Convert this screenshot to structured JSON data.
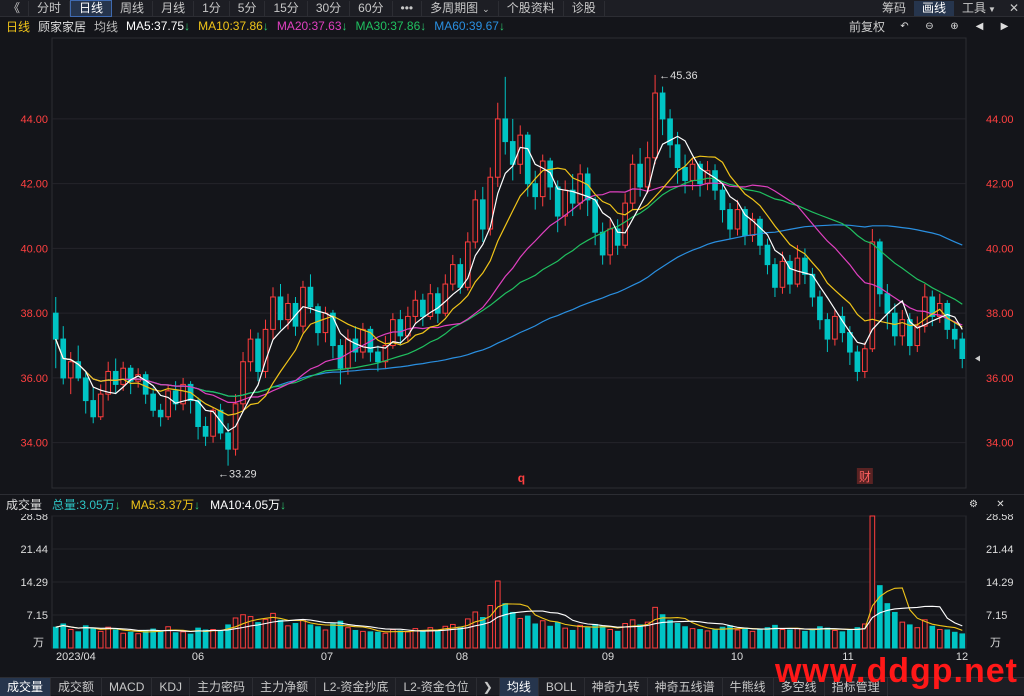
{
  "topbar": {
    "back": "《",
    "tabs": [
      "分时",
      "日线",
      "周线",
      "月线",
      "1分",
      "5分",
      "15分",
      "30分",
      "60分",
      "•••",
      "多周期图",
      "个股资料",
      "诊股"
    ],
    "active_tab": "日线",
    "dropdown_tab": "多周期图",
    "right": [
      "筹码",
      "画线",
      "工具"
    ],
    "right_active": "画线"
  },
  "ma_bar": {
    "period": "日线",
    "stock": "顾家家居",
    "label": "均线",
    "ma5": "MA5:37.75",
    "ma10": "MA10:37.86",
    "ma20": "MA20:37.63",
    "ma30": "MA30:37.86",
    "ma60": "MA60:39.67",
    "fuquan": "前复权"
  },
  "vol_bar": {
    "title": "成交量",
    "total": "总量:3.05万",
    "ma5": "MA5:3.37万",
    "ma10": "MA10:4.05万"
  },
  "bottombar": {
    "left_tabs": [
      "成交量",
      "成交额",
      "MACD",
      "KDJ",
      "主力密码",
      "主力净额",
      "L2-资金抄底",
      "L2-资金仓位"
    ],
    "left_active": "成交量",
    "right_tabs": [
      "均线",
      "BOLL",
      "神奇九转",
      "神奇五线谱",
      "牛熊线",
      "多空线",
      "指标管理"
    ],
    "right_active": "均线"
  },
  "watermark": "www.ddgp.net",
  "colors": {
    "up": "#ff3d3d",
    "down": "#00c4c4",
    "ma5": "#ffffff",
    "ma10": "#f0c419",
    "ma20": "#e040c0",
    "ma30": "#20c060",
    "ma60": "#2a8fe0"
  },
  "chart_data": {
    "type": "candlestick",
    "price_axis": {
      "ticks": [
        "44.00",
        "42.00",
        "40.00",
        "38.00",
        "36.00",
        "34.00"
      ],
      "range": [
        32.6,
        46.5
      ]
    },
    "volume_axis": {
      "ticks": [
        "28.58",
        "21.44",
        "14.29",
        "7.15"
      ],
      "unit": "万",
      "range": [
        0,
        28.58
      ]
    },
    "x_labels": [
      "2023/04",
      "06",
      "07",
      "08",
      "09",
      "10",
      "11",
      "12"
    ],
    "annotations": {
      "high": "45.36",
      "low": "33.29"
    },
    "event_markers": [
      "q",
      "财"
    ],
    "candles": [
      [
        38.0,
        37.2,
        38.5,
        36.3,
        4.5
      ],
      [
        37.2,
        36.0,
        37.6,
        35.8,
        5.2
      ],
      [
        36.0,
        36.5,
        36.8,
        35.5,
        4.0
      ],
      [
        36.5,
        36.0,
        37.0,
        35.9,
        3.5
      ],
      [
        36.0,
        35.3,
        36.2,
        34.9,
        4.8
      ],
      [
        35.3,
        34.8,
        35.7,
        34.6,
        4.2
      ],
      [
        34.8,
        35.5,
        35.8,
        34.7,
        3.6
      ],
      [
        35.5,
        36.2,
        36.5,
        35.3,
        4.5
      ],
      [
        36.2,
        35.8,
        36.6,
        35.5,
        3.9
      ],
      [
        35.8,
        36.3,
        36.5,
        35.6,
        3.2
      ],
      [
        36.3,
        35.9,
        36.4,
        35.5,
        3.4
      ],
      [
        35.9,
        36.1,
        36.3,
        35.7,
        3.1
      ],
      [
        36.1,
        35.5,
        36.2,
        35.2,
        3.8
      ],
      [
        35.5,
        35.0,
        35.7,
        34.8,
        4.1
      ],
      [
        35.0,
        34.8,
        35.2,
        34.5,
        3.7
      ],
      [
        34.8,
        35.6,
        35.8,
        34.7,
        4.6
      ],
      [
        35.6,
        35.2,
        35.9,
        35.0,
        3.3
      ],
      [
        35.2,
        35.8,
        36.0,
        35.0,
        3.5
      ],
      [
        35.8,
        35.3,
        35.9,
        34.9,
        3.0
      ],
      [
        35.3,
        34.5,
        35.4,
        34.1,
        4.3
      ],
      [
        34.5,
        34.2,
        34.8,
        33.9,
        3.9
      ],
      [
        34.2,
        35.0,
        35.1,
        34.0,
        4.0
      ],
      [
        35.0,
        34.3,
        35.2,
        34.1,
        3.6
      ],
      [
        34.3,
        33.8,
        34.6,
        33.29,
        5.0
      ],
      [
        33.8,
        35.2,
        35.5,
        33.6,
        6.5
      ],
      [
        35.2,
        36.5,
        36.8,
        35.0,
        7.2
      ],
      [
        36.5,
        37.2,
        37.5,
        36.2,
        6.8
      ],
      [
        37.2,
        36.2,
        37.4,
        35.9,
        5.5
      ],
      [
        36.2,
        37.5,
        37.8,
        36.0,
        6.2
      ],
      [
        37.5,
        38.5,
        38.8,
        37.2,
        7.5
      ],
      [
        38.5,
        37.8,
        38.9,
        37.5,
        6.0
      ],
      [
        37.8,
        38.3,
        38.6,
        37.5,
        4.8
      ],
      [
        38.3,
        37.6,
        38.5,
        37.3,
        5.3
      ],
      [
        37.6,
        38.8,
        39.0,
        37.4,
        6.1
      ],
      [
        38.8,
        38.2,
        39.2,
        38.0,
        5.0
      ],
      [
        38.2,
        37.4,
        38.3,
        37.0,
        4.6
      ],
      [
        37.4,
        38.0,
        38.2,
        37.1,
        3.9
      ],
      [
        38.0,
        37.0,
        38.1,
        36.6,
        5.2
      ],
      [
        37.0,
        36.3,
        37.2,
        35.8,
        5.8
      ],
      [
        36.3,
        37.2,
        37.5,
        36.1,
        4.4
      ],
      [
        37.2,
        36.8,
        37.6,
        36.5,
        3.8
      ],
      [
        36.8,
        37.5,
        37.7,
        36.6,
        3.6
      ],
      [
        37.5,
        36.8,
        37.6,
        36.5,
        3.5
      ],
      [
        36.8,
        36.5,
        37.0,
        36.2,
        3.4
      ],
      [
        36.5,
        37.0,
        37.3,
        36.3,
        3.2
      ],
      [
        37.0,
        37.8,
        38.0,
        36.9,
        4.0
      ],
      [
        37.8,
        37.3,
        38.1,
        37.0,
        3.7
      ],
      [
        37.3,
        37.9,
        38.2,
        37.1,
        3.5
      ],
      [
        37.9,
        38.4,
        38.7,
        37.7,
        4.2
      ],
      [
        38.4,
        37.9,
        38.6,
        37.6,
        3.6
      ],
      [
        37.9,
        38.6,
        38.9,
        37.8,
        4.4
      ],
      [
        38.6,
        38.0,
        38.8,
        37.7,
        3.9
      ],
      [
        38.0,
        38.9,
        39.2,
        37.9,
        4.7
      ],
      [
        38.9,
        39.5,
        39.8,
        38.7,
        5.1
      ],
      [
        39.5,
        38.8,
        39.7,
        38.6,
        4.5
      ],
      [
        38.8,
        40.2,
        40.5,
        38.7,
        6.3
      ],
      [
        40.2,
        41.5,
        41.8,
        40.0,
        7.8
      ],
      [
        41.5,
        40.6,
        41.9,
        40.2,
        6.6
      ],
      [
        40.6,
        42.2,
        42.5,
        40.4,
        9.2
      ],
      [
        42.2,
        44.0,
        44.5,
        41.9,
        14.5
      ],
      [
        44.0,
        43.3,
        45.3,
        42.9,
        9.6
      ],
      [
        43.3,
        42.6,
        44.0,
        42.1,
        7.7
      ],
      [
        42.6,
        43.5,
        43.8,
        42.3,
        6.4
      ],
      [
        43.5,
        42.0,
        43.6,
        41.6,
        6.9
      ],
      [
        42.0,
        41.6,
        42.4,
        41.2,
        5.2
      ],
      [
        41.6,
        42.7,
        42.9,
        41.3,
        5.9
      ],
      [
        42.7,
        41.9,
        42.8,
        41.5,
        4.7
      ],
      [
        41.9,
        41.0,
        42.1,
        40.5,
        5.5
      ],
      [
        41.0,
        41.8,
        42.1,
        40.7,
        4.3
      ],
      [
        41.8,
        41.4,
        42.3,
        41.0,
        3.8
      ],
      [
        41.4,
        42.3,
        42.6,
        41.2,
        4.9
      ],
      [
        42.3,
        41.5,
        42.5,
        41.0,
        4.4
      ],
      [
        41.5,
        40.5,
        41.6,
        40.1,
        5.1
      ],
      [
        40.5,
        39.8,
        40.8,
        39.5,
        4.7
      ],
      [
        39.8,
        40.6,
        40.9,
        39.5,
        4.0
      ],
      [
        40.6,
        40.1,
        40.9,
        39.8,
        3.6
      ],
      [
        40.1,
        41.4,
        41.7,
        40.0,
        5.3
      ],
      [
        41.4,
        42.6,
        42.9,
        41.2,
        6.1
      ],
      [
        42.6,
        41.9,
        43.1,
        41.6,
        5.0
      ],
      [
        41.9,
        42.8,
        43.3,
        41.7,
        5.6
      ],
      [
        42.8,
        44.8,
        45.36,
        42.6,
        8.8
      ],
      [
        44.8,
        44.0,
        45.0,
        43.5,
        7.2
      ],
      [
        44.0,
        43.2,
        44.3,
        42.8,
        6.0
      ],
      [
        43.2,
        42.5,
        43.6,
        42.0,
        5.3
      ],
      [
        42.5,
        42.1,
        42.9,
        41.7,
        4.6
      ],
      [
        42.1,
        42.6,
        42.8,
        41.8,
        4.2
      ],
      [
        42.6,
        42.0,
        42.7,
        41.6,
        4.0
      ],
      [
        42.0,
        42.4,
        42.7,
        41.8,
        3.7
      ],
      [
        42.4,
        41.8,
        42.6,
        41.5,
        3.9
      ],
      [
        41.8,
        41.2,
        42.0,
        40.8,
        4.5
      ],
      [
        41.2,
        40.6,
        41.4,
        40.3,
        4.8
      ],
      [
        40.6,
        41.2,
        41.5,
        40.4,
        3.9
      ],
      [
        41.2,
        40.4,
        41.3,
        40.1,
        4.3
      ],
      [
        40.4,
        40.9,
        41.1,
        40.2,
        3.6
      ],
      [
        40.9,
        40.1,
        41.0,
        39.8,
        4.1
      ],
      [
        40.1,
        39.5,
        40.3,
        39.2,
        4.4
      ],
      [
        39.5,
        38.8,
        39.7,
        38.5,
        4.9
      ],
      [
        38.8,
        39.6,
        39.9,
        38.6,
        4.0
      ],
      [
        39.6,
        38.9,
        39.8,
        38.6,
        3.9
      ],
      [
        38.9,
        39.7,
        40.1,
        38.8,
        4.2
      ],
      [
        39.7,
        39.2,
        40.0,
        38.9,
        3.6
      ],
      [
        39.2,
        38.5,
        39.4,
        38.2,
        4.1
      ],
      [
        38.5,
        37.8,
        38.7,
        37.5,
        4.6
      ],
      [
        37.8,
        37.2,
        38.0,
        36.8,
        4.3
      ],
      [
        37.2,
        37.9,
        38.1,
        37.0,
        3.8
      ],
      [
        37.9,
        37.4,
        38.2,
        37.1,
        3.5
      ],
      [
        37.4,
        36.8,
        37.6,
        36.4,
        4.0
      ],
      [
        36.8,
        36.2,
        37.0,
        35.9,
        4.4
      ],
      [
        36.2,
        36.9,
        37.1,
        36.0,
        5.2
      ],
      [
        36.9,
        40.2,
        40.6,
        36.8,
        28.58
      ],
      [
        40.2,
        38.6,
        40.3,
        38.2,
        13.5
      ],
      [
        38.6,
        38.0,
        38.9,
        37.5,
        9.6
      ],
      [
        38.0,
        37.3,
        38.3,
        37.0,
        7.7
      ],
      [
        37.3,
        37.8,
        38.1,
        37.0,
        5.6
      ],
      [
        37.8,
        37.0,
        38.0,
        36.7,
        5.0
      ],
      [
        37.0,
        37.6,
        37.9,
        36.8,
        4.4
      ],
      [
        37.6,
        38.5,
        38.9,
        37.4,
        6.1
      ],
      [
        38.5,
        37.9,
        38.7,
        37.6,
        4.7
      ],
      [
        37.9,
        38.3,
        38.6,
        37.7,
        4.0
      ],
      [
        38.3,
        37.5,
        38.4,
        37.2,
        3.9
      ],
      [
        37.5,
        37.2,
        37.7,
        36.9,
        3.4
      ],
      [
        37.2,
        36.6,
        37.4,
        36.3,
        3.05
      ]
    ]
  }
}
